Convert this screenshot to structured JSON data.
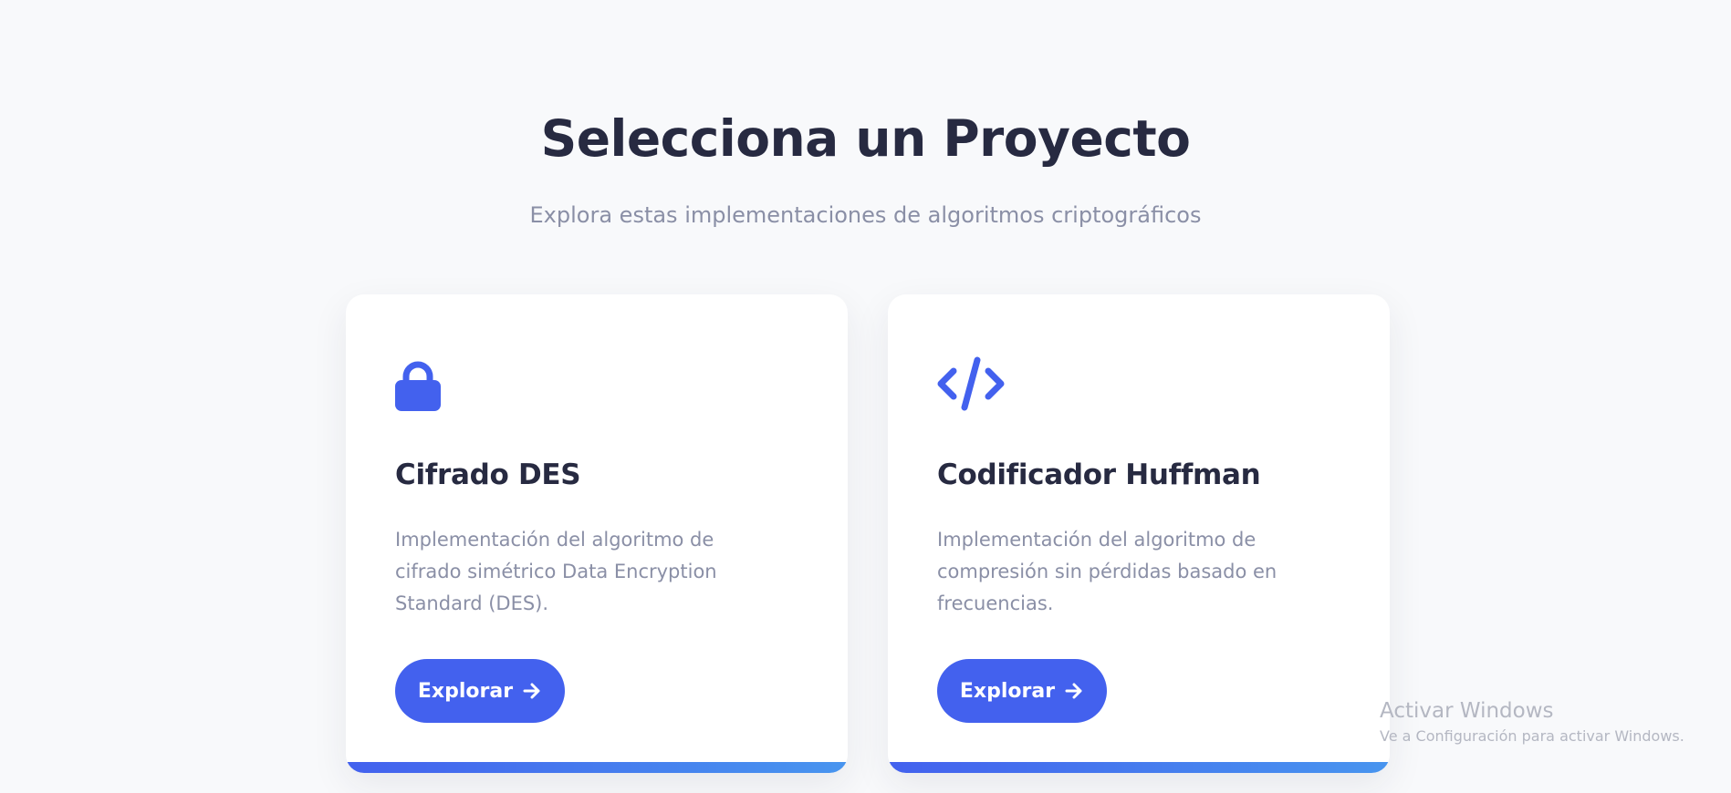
{
  "header": {
    "title": "Selecciona un Proyecto",
    "subtitle": "Explora estas implementaciones de algoritmos criptográficos"
  },
  "cards": [
    {
      "icon": "lock-icon",
      "title": "Cifrado DES",
      "description": "Implementación del algoritmo de cifrado simétrico Data Encryption Standard (DES).",
      "button_label": "Explorar",
      "button_icon": "arrow-right-icon"
    },
    {
      "icon": "code-icon",
      "title": "Codificador Huffman",
      "description": "Implementación del algoritmo de compresión sin pérdidas basado en frecuencias.",
      "button_label": "Explorar",
      "button_icon": "arrow-right-icon"
    }
  ],
  "watermark": {
    "title": "Activar Windows",
    "subtitle": "Ve a Configuración para activar Windows."
  },
  "colors": {
    "accent": "#4361ee",
    "accent_gradient_end": "#4895ef",
    "heading": "#272a41",
    "muted_text": "#8a8fa6",
    "background": "#f8f9fb"
  }
}
